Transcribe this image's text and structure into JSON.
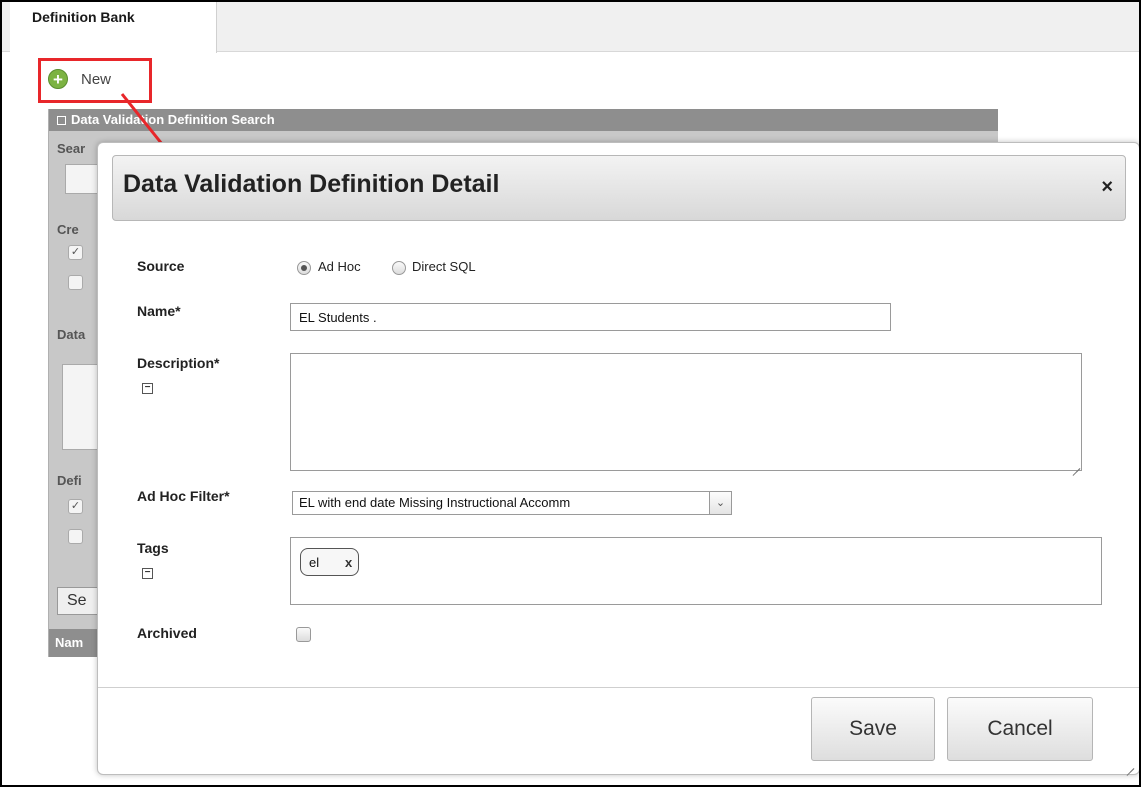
{
  "tab": {
    "label": "Definition Bank"
  },
  "toolbar": {
    "new_label": "New"
  },
  "search_panel": {
    "title": "Data Validation Definition Search",
    "label_search": "Sear",
    "label_created": "Cre",
    "label_data": "Data",
    "label_defi": "Defi",
    "search_button": "Se",
    "name_column": "Nam"
  },
  "modal": {
    "title": "Data Validation Definition Detail",
    "close": "×",
    "source": {
      "label": "Source",
      "options": [
        "Ad Hoc",
        "Direct SQL"
      ],
      "selected": "Ad Hoc"
    },
    "name": {
      "label": "Name*",
      "value": "EL Students ."
    },
    "description": {
      "label": "Description*",
      "value": ""
    },
    "ad_hoc_filter": {
      "label": "Ad Hoc Filter*",
      "value": "EL with end date Missing Instructional Accomm"
    },
    "tags": {
      "label": "Tags",
      "items": [
        {
          "text": "el",
          "remove": "x"
        }
      ]
    },
    "archived": {
      "label": "Archived",
      "checked": false
    },
    "buttons": {
      "save": "Save",
      "cancel": "Cancel"
    }
  },
  "colors": {
    "highlight": "#e8262a",
    "new_icon": "#7cb342",
    "panel_header": "#8e8e8e"
  },
  "icons": {
    "new": "plus-circle-icon",
    "close": "close-icon",
    "collapse": "minus-square-icon",
    "dropdown": "chevron-down-icon",
    "tag_remove": "close-icon"
  }
}
